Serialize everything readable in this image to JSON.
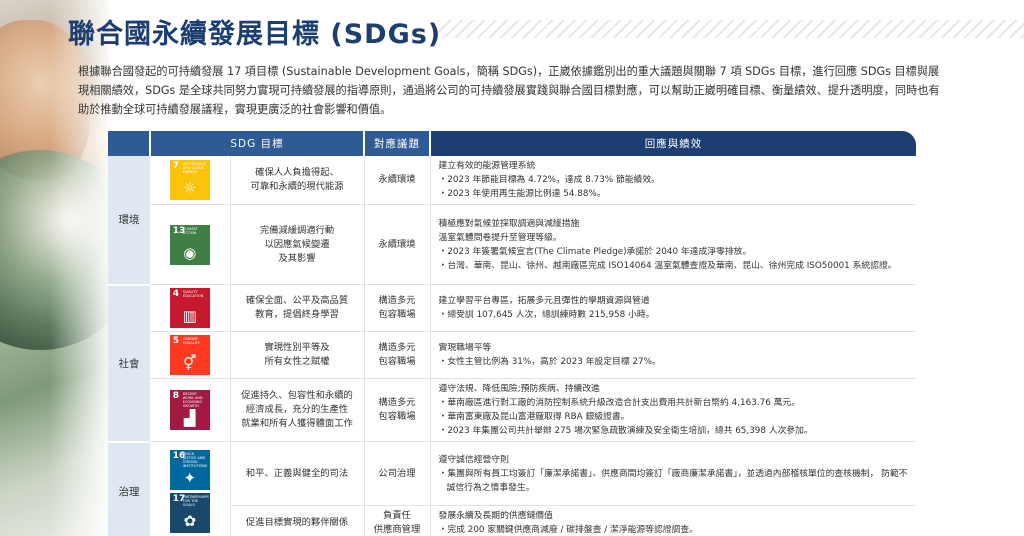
{
  "page": {
    "title": "聯合國永續發展目標 (SDGs)",
    "intro": "根據聯合國發起的可持續發展 17 項目標 (Sustainable Development Goals，簡稱 SDGs)，正崴依據鑑別出的重大議題與關聯 7 項 SDGs 目標，進行回應 SDGs 目標與展現相關績效，SDGs 是全球共同努力實現可持續發展的指導原則，通過將公司的可持續發展實踐與聯合國目標對應，可以幫助正崴明確目標、衡量績效、提升透明度，同時也有助於推動全球可持續發展議程，實現更廣泛的社會影響和價值。"
  },
  "table": {
    "headers": {
      "goal": "SDG 目標",
      "topic": "對應議題",
      "outcome": "回應與績效"
    },
    "categories": {
      "env": "環境",
      "soc": "社會",
      "gov": "治理"
    },
    "sdg_icons": [
      {
        "num": "7",
        "label": "AFFORDABLE AND CLEAN ENERGY",
        "color": "#fcc30b",
        "glyph": "☼"
      },
      {
        "num": "13",
        "label": "CLIMATE ACTION",
        "color": "#3f7e44",
        "glyph": "◉"
      },
      {
        "num": "4",
        "label": "QUALITY EDUCATION",
        "color": "#c5192d",
        "glyph": "▥"
      },
      {
        "num": "5",
        "label": "GENDER EQUALITY",
        "color": "#ff3a21",
        "glyph": "⚥"
      },
      {
        "num": "8",
        "label": "DECENT WORK AND ECONOMIC GROWTH",
        "color": "#a21942",
        "glyph": "▟"
      },
      {
        "num": "16",
        "label": "PEACE, JUSTICE AND STRONG INSTITUTIONS",
        "color": "#00689d",
        "glyph": "✦"
      },
      {
        "num": "17",
        "label": "PARTNERSHIPS FOR THE GOALS",
        "color": "#19486a",
        "glyph": "✿"
      }
    ],
    "rows": [
      {
        "goal": "確保人人負擔得起、\n可靠和永續的現代能源",
        "topic": "永續環境",
        "head": "建立有效的能源管理系統",
        "bullets": [
          "2023 年節能目標為 4.72%，達成 8.73% 節能績效。",
          "2023 年使用再生能源比例達 54.88%。"
        ]
      },
      {
        "goal": "完備減緩調適行動\n以因應氣候變遷\n及其影響",
        "topic": "永續環境",
        "head": "積極應對氣候並採取調適與減緩措施\n溫室氣體問卷提升至管理等級。",
        "bullets": [
          "2023 年簽署氣候宣言(The Climate Pledge)承諾於 2040 年達成淨零排放。",
          "台灣、華南、昆山、徐州、越南廠區完成 ISO14064 溫室氣體查證及華南、昆山、徐州完成 ISO50001 系統認證。"
        ]
      },
      {
        "goal": "確保全面、公平及高品質\n教育，提倡終身學習",
        "topic": "構造多元\n包容職場",
        "head": "建立學習平台專區，拓展多元且彈性的學期資源與管道",
        "bullets": [
          "總受訓 107,645 人次，總訓練時數 215,958 小時。"
        ]
      },
      {
        "goal": "實現性別平等及\n所有女性之賦權",
        "topic": "構造多元\n包容職場",
        "head": "實現職場平等",
        "bullets": [
          "女性主管比例為 31%，高於 2023 年設定目標 27%。"
        ]
      },
      {
        "goal": "促進持久、包容性和永續的\n經濟成長，充分的生產性\n就業和所有人獲得體面工作",
        "topic": "構造多元\n包容職場",
        "head": "遵守法規、降低風險;預防疾病、持續改進",
        "bullets": [
          "華南廠區進行對工廠的消防控制系統升級改造合計支出費用共計新台幣約 4,163.76 萬元。",
          "華南富東廠及昆山富港廠取得 RBA 銀級證書。",
          "2023 年集團公司共計舉辦 275 場次緊急疏散演練及安全衛生培訓，總共 65,398 人次參加。"
        ]
      },
      {
        "goal": "和平、正義與健全的司法",
        "topic": "公司治理",
        "head": "遵守誠信經營守則",
        "bullets": [
          "集團與所有員工均簽訂「廉潔承諾書」、供應商間均簽訂「廠商廉潔承諾書」，並透過內部稽核單位的查核機制， 防範不誠信行為之情事發生。"
        ]
      },
      {
        "goal": "促進目標實現的夥伴關係",
        "topic": "負責任\n供應商管理",
        "head": "發展永續及長期的供應鏈價值",
        "bullets": [
          "完成 200 家關鍵供應商減廢 / 碳排盤查 / 潔淨能源等認證調查。"
        ]
      }
    ]
  },
  "colors": {
    "title": "#1d3e70",
    "header_light": "#2e5a95",
    "header_dark": "#1d3e70",
    "category_bg": "#dfe7f2"
  }
}
